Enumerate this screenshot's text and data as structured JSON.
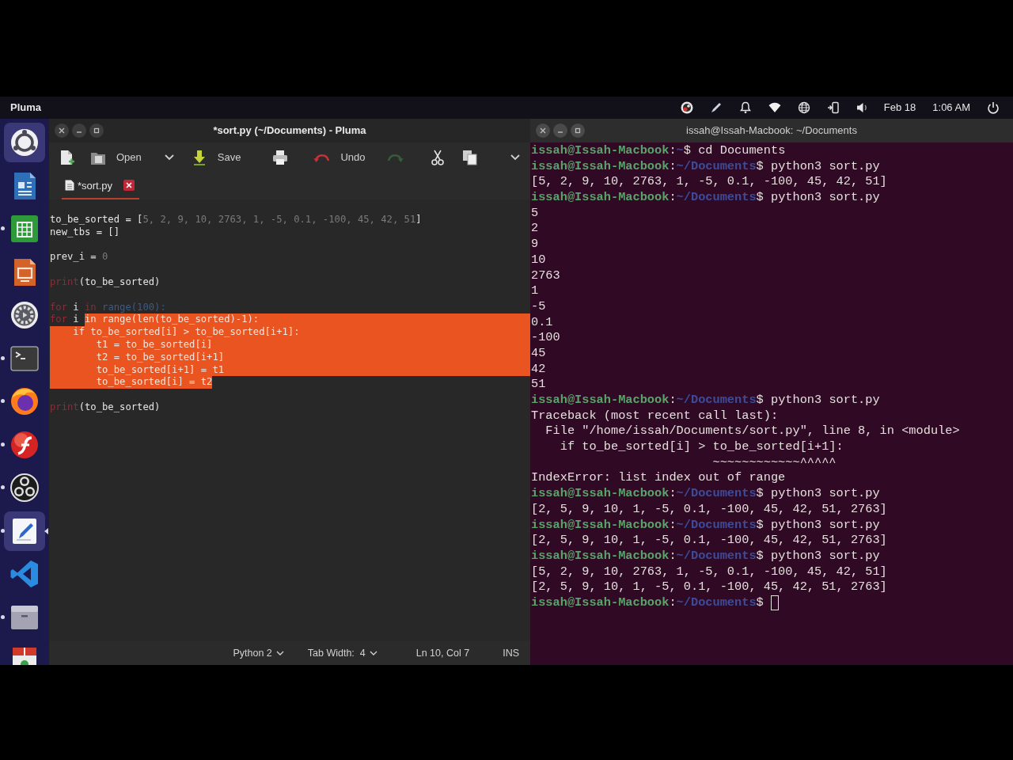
{
  "top_bar": {
    "app_name": "Pluma",
    "date": "Feb 18",
    "time": "1:06 AM"
  },
  "dock": {
    "apps": [
      {
        "kind": "ring",
        "running": false,
        "highlighted": true,
        "active": false
      },
      {
        "kind": "document",
        "running": false,
        "highlighted": false,
        "active": false
      },
      {
        "kind": "spreadsheet",
        "running": true,
        "highlighted": false,
        "active": false
      },
      {
        "kind": "slides",
        "running": false,
        "highlighted": false,
        "active": false
      },
      {
        "kind": "gear",
        "running": false,
        "highlighted": false,
        "active": false
      },
      {
        "kind": "terminal",
        "running": true,
        "highlighted": false,
        "active": false
      },
      {
        "kind": "fox",
        "running": true,
        "highlighted": false,
        "active": false
      },
      {
        "kind": "swoosh",
        "running": true,
        "highlighted": false,
        "active": false
      },
      {
        "kind": "circles",
        "running": true,
        "highlighted": false,
        "active": false
      },
      {
        "kind": "notepad",
        "running": true,
        "highlighted": true,
        "active": true
      },
      {
        "kind": "ribbon",
        "running": false,
        "highlighted": false,
        "active": false
      },
      {
        "kind": "drawer",
        "running": true,
        "highlighted": false,
        "active": false
      },
      {
        "kind": "package",
        "running": false,
        "highlighted": false,
        "active": false
      }
    ]
  },
  "editor": {
    "title": "*sort.py (~/Documents) - Pluma",
    "toolbar": [
      {
        "kind": "new",
        "disabled": false
      },
      {
        "kind": "open",
        "label": "Open",
        "disabled": false
      },
      {
        "kind": "menu",
        "disabled": false
      },
      {
        "kind": "save",
        "label": "Save",
        "disabled": false
      },
      {
        "kind": "print",
        "disabled": false
      },
      {
        "kind": "undo",
        "label": "Undo",
        "disabled": false
      },
      {
        "kind": "redo",
        "disabled": true
      },
      {
        "kind": "cut",
        "disabled": false
      },
      {
        "kind": "copy",
        "disabled": false
      }
    ],
    "tabs": [
      {
        "label": "*sort.py",
        "selected": true
      }
    ],
    "lines": [
      {
        "tokens": [
          {
            "text": "to_be_sorted = [",
            "kind": "plain",
            "selected": false
          },
          {
            "text": "5, 2, 9, 10, 2763, 1, -5, 0.1, -100, 45, 42, 51",
            "kind": "number",
            "selected": false
          },
          {
            "text": "]",
            "kind": "plain",
            "selected": false
          }
        ],
        "selected_to_end": false
      },
      {
        "tokens": [
          {
            "text": "new_tbs = []",
            "kind": "plain",
            "selected": false
          }
        ],
        "selected_to_end": false
      },
      {
        "selected_to_end": false
      },
      {
        "tokens": [
          {
            "text": "prev_i = ",
            "kind": "plain",
            "selected": false
          },
          {
            "text": "0",
            "kind": "number",
            "selected": false
          }
        ],
        "selected_to_end": false
      },
      {
        "selected_to_end": false
      },
      {
        "tokens": [
          {
            "text": "print",
            "kind": "keyword",
            "selected": false
          },
          {
            "text": "(to_be_sorted)",
            "kind": "plain",
            "selected": false
          }
        ],
        "selected_to_end": false
      },
      {
        "selected_to_end": false
      },
      {
        "tokens": [
          {
            "text": "for",
            "kind": "keyword",
            "selected": false
          },
          {
            "text": " i ",
            "kind": "plain",
            "selected": false
          },
          {
            "text": "in",
            "kind": "keyword",
            "selected": false
          },
          {
            "text": " range(100):",
            "kind": "builtin",
            "selected": false
          }
        ],
        "selected_to_end": false
      },
      {
        "tokens": [
          {
            "text": "for",
            "kind": "keyword",
            "selected": false
          },
          {
            "text": " i ",
            "kind": "plain",
            "selected": false
          },
          {
            "text": "in range(len(to_be_sorted)-1):",
            "selected": true
          }
        ],
        "selected_to_end": true
      },
      {
        "tokens": [
          {
            "text": "    if to_be_sorted[i] > to_be_sorted[i+1]:",
            "selected": true
          }
        ],
        "selected_to_end": true
      },
      {
        "tokens": [
          {
            "text": "        t1 = to_be_sorted[i]",
            "selected": true
          }
        ],
        "selected_to_end": true
      },
      {
        "tokens": [
          {
            "text": "        t2 = to_be_sorted[i+1]",
            "selected": true
          }
        ],
        "selected_to_end": true
      },
      {
        "tokens": [
          {
            "text": "        to_be_sorted[i+1] = t1",
            "selected": true
          }
        ],
        "selected_to_end": true
      },
      {
        "tokens": [
          {
            "text": "        to_be_sorted[i] = t2",
            "selected": true
          }
        ],
        "selected_to_end": false
      },
      {
        "selected_to_end": false
      },
      {
        "tokens": [
          {
            "text": "print",
            "kind": "keyword",
            "selected": false
          },
          {
            "text": "(to_be_sorted)",
            "kind": "plain",
            "selected": false
          }
        ],
        "selected_to_end": false
      }
    ],
    "status_bar": [
      {
        "label": "Python 2",
        "dropdown": true
      },
      {
        "label": "Tab Width:  4",
        "dropdown": true
      },
      {
        "label": "Ln 10, Col 7",
        "dropdown": false
      },
      {
        "label": "INS",
        "dropdown": false
      }
    ]
  },
  "terminal": {
    "title": "issah@Issah-Macbook: ~/Documents",
    "cursor": true,
    "lines": [
      {
        "kind": "prompt",
        "host": "issah@Issah-Macbook",
        "separator": ":",
        "path": "~",
        "sign": "$",
        "command": "cd Documents"
      },
      {
        "kind": "prompt",
        "host": "issah@Issah-Macbook",
        "separator": ":",
        "path": "~/Documents",
        "sign": "$",
        "command": "python3 sort.py"
      },
      {
        "kind": "output",
        "text": "[5, 2, 9, 10, 2763, 1, -5, 0.1, -100, 45, 42, 51]"
      },
      {
        "kind": "prompt",
        "host": "issah@Issah-Macbook",
        "separator": ":",
        "path": "~/Documents",
        "sign": "$",
        "command": "python3 sort.py"
      },
      {
        "kind": "output",
        "text": "5"
      },
      {
        "kind": "output",
        "text": "2"
      },
      {
        "kind": "output",
        "text": "9"
      },
      {
        "kind": "output",
        "text": "10"
      },
      {
        "kind": "output",
        "text": "2763"
      },
      {
        "kind": "output",
        "text": "1"
      },
      {
        "kind": "output",
        "text": "-5"
      },
      {
        "kind": "output",
        "text": "0.1"
      },
      {
        "kind": "output",
        "text": "-100"
      },
      {
        "kind": "output",
        "text": "45"
      },
      {
        "kind": "output",
        "text": "42"
      },
      {
        "kind": "output",
        "text": "51"
      },
      {
        "kind": "prompt",
        "host": "issah@Issah-Macbook",
        "separator": ":",
        "path": "~/Documents",
        "sign": "$",
        "command": "python3 sort.py"
      },
      {
        "kind": "output",
        "text": "Traceback (most recent call last):"
      },
      {
        "kind": "output",
        "text": "  File \"/home/issah/Documents/sort.py\", line 8, in <module>"
      },
      {
        "kind": "output",
        "text": "    if to_be_sorted[i] > to_be_sorted[i+1]:"
      },
      {
        "kind": "output",
        "text": "                         ~~~~~~~~~~~~^^^^^"
      },
      {
        "kind": "output",
        "text": "IndexError: list index out of range"
      },
      {
        "kind": "prompt",
        "host": "issah@Issah-Macbook",
        "separator": ":",
        "path": "~/Documents",
        "sign": "$",
        "command": "python3 sort.py"
      },
      {
        "kind": "output",
        "text": "[2, 5, 9, 10, 1, -5, 0.1, -100, 45, 42, 51, 2763]"
      },
      {
        "kind": "prompt",
        "host": "issah@Issah-Macbook",
        "separator": ":",
        "path": "~/Documents",
        "sign": "$",
        "command": "python3 sort.py"
      },
      {
        "kind": "output",
        "text": "[2, 5, 9, 10, 1, -5, 0.1, -100, 45, 42, 51, 2763]"
      },
      {
        "kind": "prompt",
        "host": "issah@Issah-Macbook",
        "separator": ":",
        "path": "~/Documents",
        "sign": "$",
        "command": "python3 sort.py"
      },
      {
        "kind": "output",
        "text": "[5, 2, 9, 10, 2763, 1, -5, 0.1, -100, 45, 42, 51]"
      },
      {
        "kind": "output",
        "text": "[2, 5, 9, 10, 1, -5, 0.1, -100, 45, 42, 51, 2763]"
      },
      {
        "kind": "prompt",
        "host": "issah@Issah-Macbook",
        "separator": ":",
        "path": "~/Documents",
        "sign": "$"
      }
    ]
  }
}
